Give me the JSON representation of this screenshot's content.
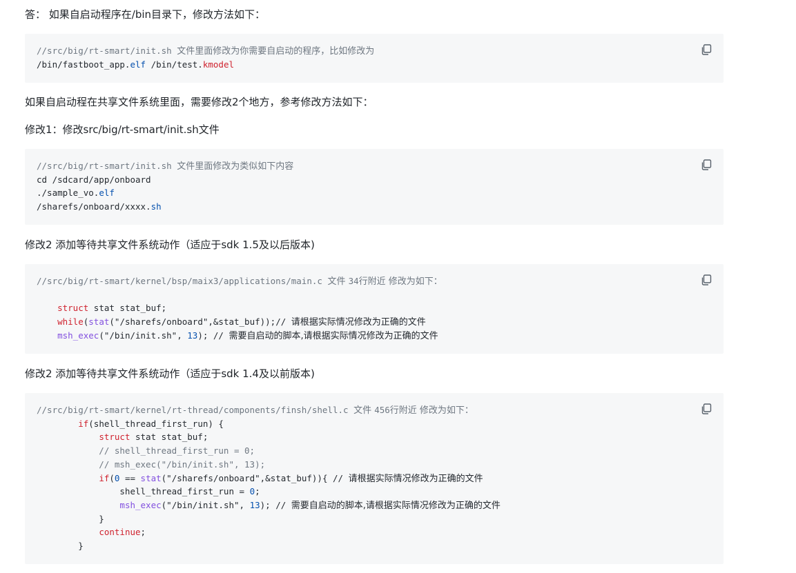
{
  "paragraphs": {
    "p1": "答： 如果自启动程序在/bin目录下，修改方法如下：",
    "p2": "如果自启动程在共享文件系统里面，需要修改2个地方，参考修改方法如下：",
    "p3": "修改1：修改src/big/rt-smart/init.sh文件",
    "p4": "修改2 添加等待共享文件系统动作（适应于sdk 1.5及以后版本)",
    "p5": "修改2 添加等待共享文件系统动作（适应于sdk 1.4及以前版本)"
  },
  "blocks": [
    {
      "lines": [
        [
          {
            "t": "//src/big/rt-smart/init.sh ",
            "c": "c-gray"
          },
          {
            "t": "文件里面修改为你需要自启动的程序，比如修改为",
            "c": "c-gray c-cn"
          }
        ],
        [
          {
            "t": "/bin/fastboot_app.",
            "c": "c-plain"
          },
          {
            "t": "elf",
            "c": "c-blue"
          },
          {
            "t": " /bin/test.",
            "c": "c-plain"
          },
          {
            "t": "kmodel",
            "c": "c-kw"
          }
        ]
      ]
    },
    {
      "lines": [
        [
          {
            "t": "//src/big/rt-smart/init.sh ",
            "c": "c-gray"
          },
          {
            "t": "文件里面修改为类似如下内容",
            "c": "c-gray c-cn"
          }
        ],
        [
          {
            "t": "cd /sdcard/app/onboard",
            "c": "c-plain"
          }
        ],
        [
          {
            "t": "./sample_vo.",
            "c": "c-plain"
          },
          {
            "t": "elf",
            "c": "c-blue"
          }
        ],
        [
          {
            "t": "/sharefs/onboard/xxxx.",
            "c": "c-plain"
          },
          {
            "t": "sh",
            "c": "c-blue"
          }
        ]
      ]
    },
    {
      "lines": [
        [
          {
            "t": "//src/big/rt-smart/kernel/bsp/maix3/applications/main.c ",
            "c": "c-gray"
          },
          {
            "t": "文件 ",
            "c": "c-gray c-cn"
          },
          {
            "t": "34",
            "c": "c-gray"
          },
          {
            "t": "行附近 修改为如下：",
            "c": "c-gray c-cn"
          }
        ],
        [],
        [
          {
            "t": "    ",
            "c": "c-plain"
          },
          {
            "t": "struct",
            "c": "c-kw"
          },
          {
            "t": " stat stat_buf;",
            "c": "c-plain"
          }
        ],
        [
          {
            "t": "    ",
            "c": "c-plain"
          },
          {
            "t": "while",
            "c": "c-kw"
          },
          {
            "t": "(",
            "c": "c-plain"
          },
          {
            "t": "stat",
            "c": "c-fn"
          },
          {
            "t": "(\"/sharefs/onboard\",&stat_buf));// ",
            "c": "c-plain"
          },
          {
            "t": "请根据实际情况修改为正确的文件",
            "c": "c-plain c-cn"
          }
        ],
        [
          {
            "t": "    ",
            "c": "c-plain"
          },
          {
            "t": "msh_exec",
            "c": "c-fn"
          },
          {
            "t": "(\"/bin/init.sh\", ",
            "c": "c-plain"
          },
          {
            "t": "13",
            "c": "c-num"
          },
          {
            "t": "); // ",
            "c": "c-plain"
          },
          {
            "t": "需要自启动的脚本,请根据实际情况修改为正确的文件",
            "c": "c-plain c-cn"
          }
        ]
      ]
    },
    {
      "lines": [
        [
          {
            "t": "//src/big/rt-smart/kernel/rt-thread/components/finsh/shell.c ",
            "c": "c-gray"
          },
          {
            "t": "文件 ",
            "c": "c-gray c-cn"
          },
          {
            "t": "456",
            "c": "c-gray"
          },
          {
            "t": "行附近 修改为如下：",
            "c": "c-gray c-cn"
          }
        ],
        [
          {
            "t": "        ",
            "c": "c-plain"
          },
          {
            "t": "if",
            "c": "c-kw"
          },
          {
            "t": "(shell_thread_first_run) {",
            "c": "c-plain"
          }
        ],
        [
          {
            "t": "            ",
            "c": "c-plain"
          },
          {
            "t": "struct",
            "c": "c-kw"
          },
          {
            "t": " stat stat_buf;",
            "c": "c-plain"
          }
        ],
        [
          {
            "t": "            // shell_thread_first_run = 0;",
            "c": "c-gray"
          }
        ],
        [
          {
            "t": "            // msh_exec(\"/bin/init.sh\", 13);",
            "c": "c-gray"
          }
        ],
        [
          {
            "t": "            ",
            "c": "c-plain"
          },
          {
            "t": "if",
            "c": "c-kw"
          },
          {
            "t": "(",
            "c": "c-plain"
          },
          {
            "t": "0",
            "c": "c-num"
          },
          {
            "t": " == ",
            "c": "c-plain"
          },
          {
            "t": "stat",
            "c": "c-fn"
          },
          {
            "t": "(\"/sharefs/onboard\",&stat_buf)){ // ",
            "c": "c-plain"
          },
          {
            "t": "请根据实际情况修改为正确的文件",
            "c": "c-plain c-cn"
          }
        ],
        [
          {
            "t": "                shell_thread_first_run = ",
            "c": "c-plain"
          },
          {
            "t": "0",
            "c": "c-num"
          },
          {
            "t": ";",
            "c": "c-plain"
          }
        ],
        [
          {
            "t": "                ",
            "c": "c-plain"
          },
          {
            "t": "msh_exec",
            "c": "c-fn"
          },
          {
            "t": "(\"/bin/init.sh\", ",
            "c": "c-plain"
          },
          {
            "t": "13",
            "c": "c-num"
          },
          {
            "t": "); // ",
            "c": "c-plain"
          },
          {
            "t": "需要自启动的脚本,请根据实际情况修改为正确的文件",
            "c": "c-plain c-cn"
          }
        ],
        [
          {
            "t": "            }",
            "c": "c-plain"
          }
        ],
        [
          {
            "t": "            ",
            "c": "c-plain"
          },
          {
            "t": "continue",
            "c": "c-kw"
          },
          {
            "t": ";",
            "c": "c-plain"
          }
        ],
        [
          {
            "t": "        }",
            "c": "c-plain"
          }
        ]
      ]
    }
  ]
}
